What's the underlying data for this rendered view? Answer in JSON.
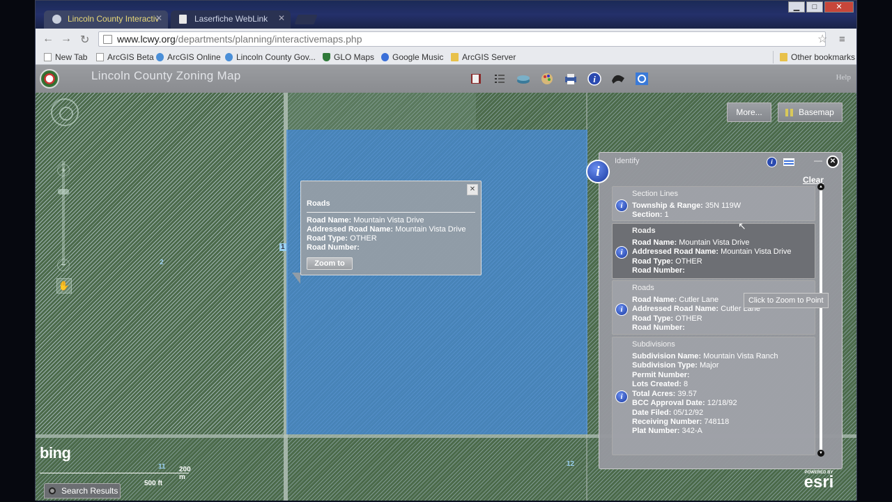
{
  "browser": {
    "tabs": [
      {
        "label": "Lincoln County Interactiv"
      },
      {
        "label": "Laserfiche WebLink"
      }
    ],
    "url_domain": "www.lcwy.org",
    "url_path": "/departments/planning/interactivemaps.php",
    "bookmarks": [
      {
        "label": "New Tab",
        "icon": "page-icon"
      },
      {
        "label": "ArcGIS Beta",
        "icon": "page-icon"
      },
      {
        "label": "ArcGIS Online",
        "icon": "globe-icon"
      },
      {
        "label": "Lincoln County Gov...",
        "icon": "globe-icon"
      },
      {
        "label": "GLO Maps",
        "icon": "shield-icon"
      },
      {
        "label": "Google Music",
        "icon": "google-icon"
      },
      {
        "label": "ArcGIS Server",
        "icon": "folder-icon"
      }
    ],
    "other_bookmarks": "Other bookmarks"
  },
  "app": {
    "title": "Lincoln County Zoning Map",
    "help": "Help",
    "tools": [
      "book-icon",
      "list-icon",
      "layers-icon",
      "palette-icon",
      "print-icon",
      "info-icon",
      "draw-icon",
      "settings-icon"
    ]
  },
  "map": {
    "more_button": "More...",
    "basemap_button": "Basemap",
    "bing": "bing",
    "scale_m": "200 m",
    "scale_ft": "500 ft",
    "search_results": "Search Results",
    "labels": [
      "2",
      "1",
      "11",
      "12"
    ],
    "esri_powered": "POWERED BY",
    "esri": "esri"
  },
  "popup": {
    "title": "Roads",
    "rows": [
      {
        "k": "Road Name:",
        "v": "Mountain Vista Drive"
      },
      {
        "k": "Addressed Road Name:",
        "v": "Mountain Vista Drive"
      },
      {
        "k": "Road Type:",
        "v": "OTHER"
      },
      {
        "k": "Road Number:",
        "v": ""
      }
    ],
    "zoom_button": "Zoom to"
  },
  "identify": {
    "title": "Identify",
    "clear": "Clear",
    "tooltip": "Click to Zoom to Point",
    "results": [
      {
        "layer": "Section Lines",
        "fields": [
          {
            "k": "Township & Range:",
            "v": "35N 119W"
          },
          {
            "k": "Section:",
            "v": "1"
          }
        ]
      },
      {
        "layer": "Roads",
        "fields": [
          {
            "k": "Road Name:",
            "v": "Mountain Vista Drive"
          },
          {
            "k": "Addressed Road Name:",
            "v": "Mountain Vista Drive"
          },
          {
            "k": "Road Type:",
            "v": "OTHER"
          },
          {
            "k": "Road Number:",
            "v": ""
          }
        ]
      },
      {
        "layer": "Roads",
        "fields": [
          {
            "k": "Road Name:",
            "v": "Cutler Lane"
          },
          {
            "k": "Addressed Road Name:",
            "v": "Cutler Lane"
          },
          {
            "k": "Road Type:",
            "v": "OTHER"
          },
          {
            "k": "Road Number:",
            "v": ""
          }
        ]
      },
      {
        "layer": "Subdivisions",
        "fields": [
          {
            "k": "Subdivision Name:",
            "v": "Mountain Vista Ranch"
          },
          {
            "k": "Subdivision Type:",
            "v": "Major"
          },
          {
            "k": "Permit Number:",
            "v": ""
          },
          {
            "k": "Lots Created:",
            "v": "8"
          },
          {
            "k": "Total Acres:",
            "v": "39.57"
          },
          {
            "k": "BCC Approval Date:",
            "v": "12/18/92"
          },
          {
            "k": "Date Filed:",
            "v": "05/12/92"
          },
          {
            "k": "Receiving Number:",
            "v": "748118"
          },
          {
            "k": "Plat Number:",
            "v": "342-A"
          }
        ]
      }
    ]
  }
}
